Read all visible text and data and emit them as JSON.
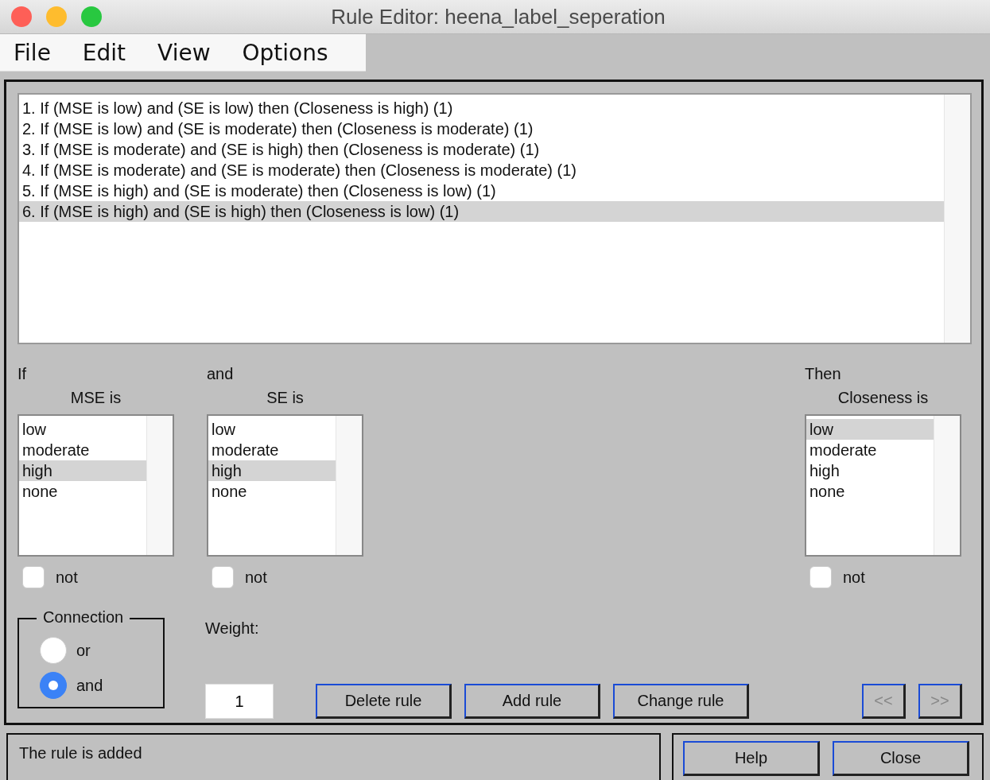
{
  "window": {
    "title": "Rule Editor: heena_label_seperation"
  },
  "menu": [
    "File",
    "Edit",
    "View",
    "Options"
  ],
  "rules": [
    {
      "text": "1. If (MSE is low) and (SE is low) then (Closeness is high) (1)",
      "selected": false
    },
    {
      "text": "2. If (MSE is low) and (SE is moderate) then (Closeness is moderate) (1)",
      "selected": false
    },
    {
      "text": "3. If (MSE is moderate) and (SE is high) then (Closeness is moderate) (1)",
      "selected": false
    },
    {
      "text": "4. If (MSE is moderate) and (SE is moderate) then (Closeness is moderate) (1)",
      "selected": false
    },
    {
      "text": "5. If (MSE is high) and (SE is moderate) then (Closeness is low) (1)",
      "selected": false
    },
    {
      "text": "6. If (MSE is high) and (SE is high) then (Closeness is low) (1)",
      "selected": true
    }
  ],
  "variables": [
    {
      "heading": "If",
      "label": "MSE is",
      "not_label": "not",
      "not": false,
      "options": [
        {
          "label": "low",
          "selected": false
        },
        {
          "label": "moderate",
          "selected": false
        },
        {
          "label": "high",
          "selected": true
        },
        {
          "label": "none",
          "selected": false
        }
      ]
    },
    {
      "heading": "and",
      "label": "SE is",
      "not_label": "not",
      "not": false,
      "options": [
        {
          "label": "low",
          "selected": false
        },
        {
          "label": "moderate",
          "selected": false
        },
        {
          "label": "high",
          "selected": true
        },
        {
          "label": "none",
          "selected": false
        }
      ]
    },
    {
      "heading": "Then",
      "label": "Closeness is",
      "not_label": "not",
      "not": false,
      "options": [
        {
          "label": "low",
          "selected": true
        },
        {
          "label": "moderate",
          "selected": false
        },
        {
          "label": "high",
          "selected": false
        },
        {
          "label": "none",
          "selected": false
        }
      ]
    }
  ],
  "connection": {
    "title": "Connection",
    "options": [
      {
        "label": "or",
        "selected": false
      },
      {
        "label": "and",
        "selected": true
      }
    ]
  },
  "weight": {
    "label": "Weight:",
    "value": "1"
  },
  "actions": [
    {
      "label": "Delete rule",
      "disabled": false
    },
    {
      "label": "Add rule",
      "disabled": false
    },
    {
      "label": "Change rule",
      "disabled": false
    }
  ],
  "nav": [
    {
      "label": "<<",
      "disabled": true
    },
    {
      "label": ">>",
      "disabled": true
    }
  ],
  "status": "The rule is added",
  "footer_buttons": [
    "Help",
    "Close"
  ]
}
